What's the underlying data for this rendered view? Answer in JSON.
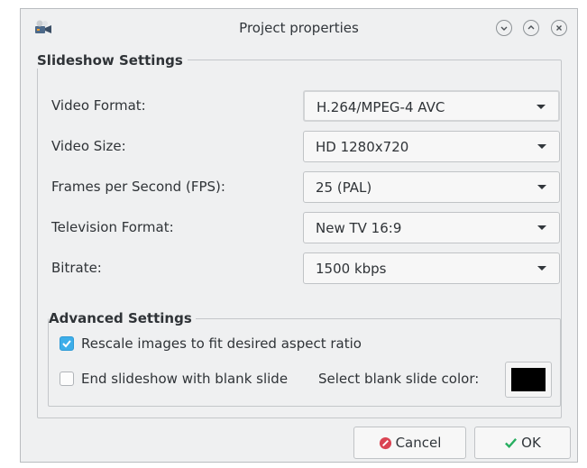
{
  "window": {
    "title": "Project properties",
    "icon": "slideshow-app-icon",
    "controls": [
      "minimize-icon",
      "maximize-icon",
      "close-icon"
    ]
  },
  "slideshow_settings": {
    "title": "Slideshow Settings",
    "rows": [
      {
        "label": "Video Format:",
        "value": "H.264/MPEG-4 AVC"
      },
      {
        "label": "Video Size:",
        "value": "HD 1280x720"
      },
      {
        "label": "Frames per Second (FPS):",
        "value": "25 (PAL)"
      },
      {
        "label": "Television Format:",
        "value": "New TV 16:9"
      },
      {
        "label": "Bitrate:",
        "value": "1500 kbps"
      }
    ]
  },
  "advanced_settings": {
    "title": "Advanced Settings",
    "rescale": {
      "label": "Rescale images to fit desired aspect ratio",
      "checked": true
    },
    "blank_slide": {
      "label": "End slideshow with blank slide",
      "checked": false
    },
    "blank_color_label": "Select blank slide color:",
    "blank_color": "#000000"
  },
  "buttons": {
    "cancel": "Cancel",
    "ok": "OK"
  },
  "colors": {
    "accent": "#3daee9",
    "cancel_icon": "#da4453",
    "ok_icon": "#27ae60"
  }
}
